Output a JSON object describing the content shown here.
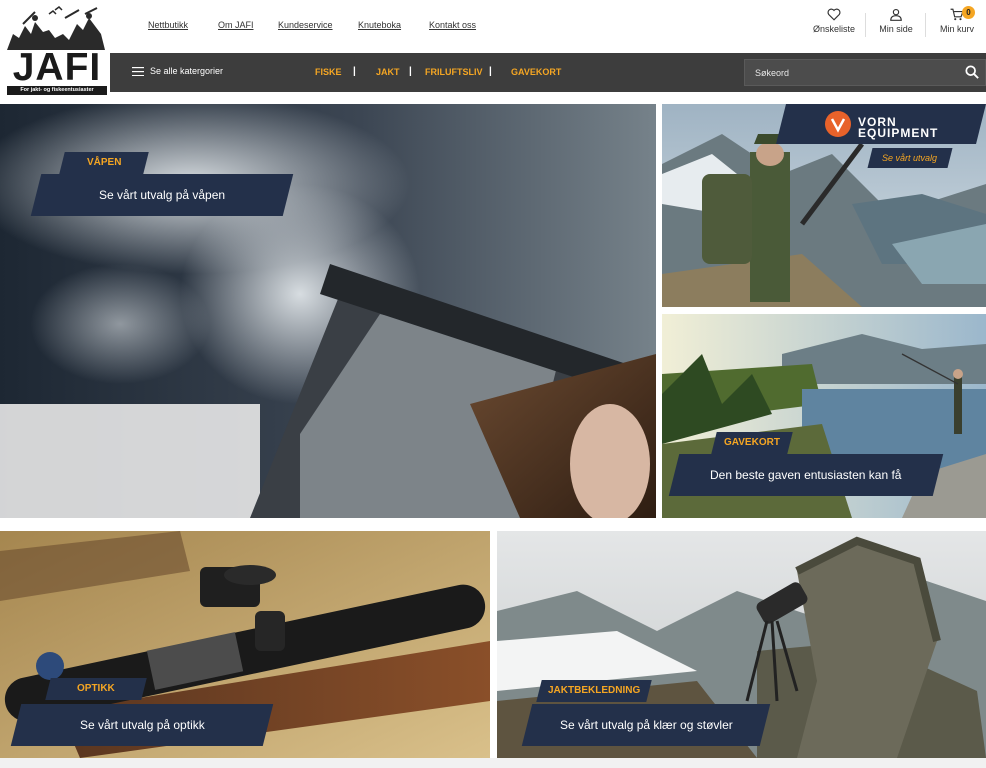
{
  "brand": {
    "name": "JAFI",
    "tagline": "For jakt- og fiskeentusiaster"
  },
  "topnav": [
    {
      "label": "Nettbutikk"
    },
    {
      "label": "Om JAFI"
    },
    {
      "label": "Kundeservice"
    },
    {
      "label": "Knuteboka"
    },
    {
      "label": "Kontakt oss"
    }
  ],
  "utility": {
    "wishlist": "Ønskeliste",
    "account": "Min side",
    "cart": "Min kurv",
    "cart_count": "0"
  },
  "bar": {
    "all_categories": "Se alle katergorier",
    "categories": [
      "FISKE",
      "JAKT",
      "FRILUFTSLIV",
      "GAVEKORT"
    ],
    "separator": "|",
    "search_placeholder": "Søkeord"
  },
  "banners": {
    "weapons": {
      "tag": "VÅPEN",
      "text": "Se vårt utvalg på våpen"
    },
    "vorn": {
      "logo": "VORN EQUIPMENT",
      "logo_line1": "VORN",
      "logo_line2": "EQUIPMENT",
      "sub": "Se vårt utvalg"
    },
    "giftcard": {
      "tag": "GAVEKORT",
      "text": "Den beste gaven entusiasten kan få"
    },
    "optics": {
      "tag": "OPTIKK",
      "text": "Se vårt utvalg på optikk"
    },
    "clothing": {
      "tag": "JAKTBEKLEDNING",
      "text": "Se vårt utvalg på klær og støvler"
    }
  },
  "colors": {
    "accent": "#f5a623",
    "navy": "#23304a",
    "bar": "#3d3d3d"
  }
}
